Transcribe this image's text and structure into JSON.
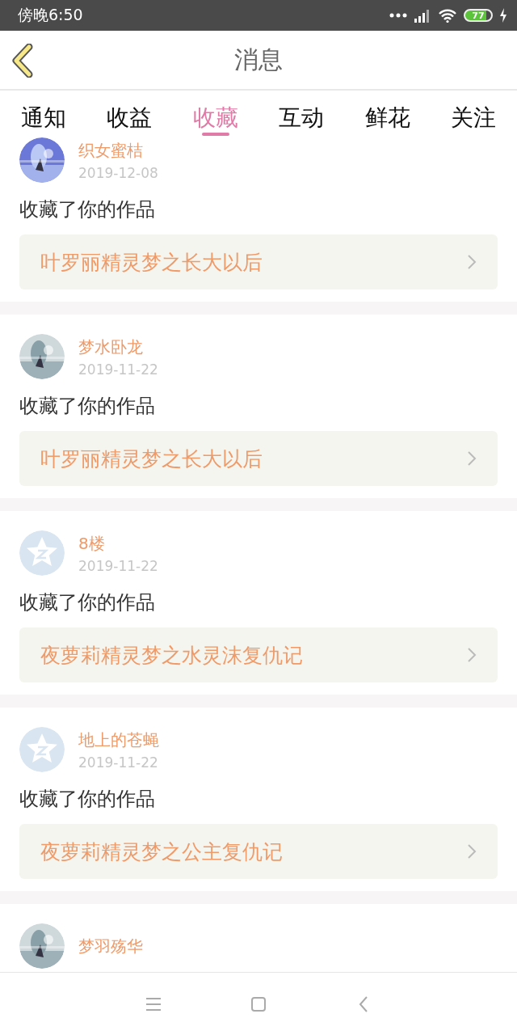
{
  "status_bar": {
    "time": "傍晚6:50",
    "battery": "77"
  },
  "header": {
    "title": "消息"
  },
  "tabs": [
    {
      "label": "通知",
      "selected": false
    },
    {
      "label": "收益",
      "selected": false
    },
    {
      "label": "收藏",
      "selected": true
    },
    {
      "label": "互动",
      "selected": false
    },
    {
      "label": "鲜花",
      "selected": false
    },
    {
      "label": "关注",
      "selected": false
    }
  ],
  "items": [
    {
      "kind": "picture",
      "user": "织女蜜桔",
      "date": "2019-12-08",
      "action": "收藏了你的作品",
      "work": "叶罗丽精灵梦之长大以后"
    },
    {
      "kind": "picture",
      "user": "梦水卧龙",
      "date": "2019-11-22",
      "action": "收藏了你的作品",
      "work": "叶罗丽精灵梦之长大以后"
    },
    {
      "kind": "default",
      "user": "8楼",
      "date": "2019-11-22",
      "action": "收藏了你的作品",
      "work": "夜萝莉精灵梦之水灵沫复仇记"
    },
    {
      "kind": "default",
      "user": "地上的苍蝇",
      "date": "2019-11-22",
      "action": "收藏了你的作品",
      "work": "夜萝莉精灵梦之公主复仇记"
    },
    {
      "kind": "picture",
      "user": "梦羽殇华"
    }
  ]
}
